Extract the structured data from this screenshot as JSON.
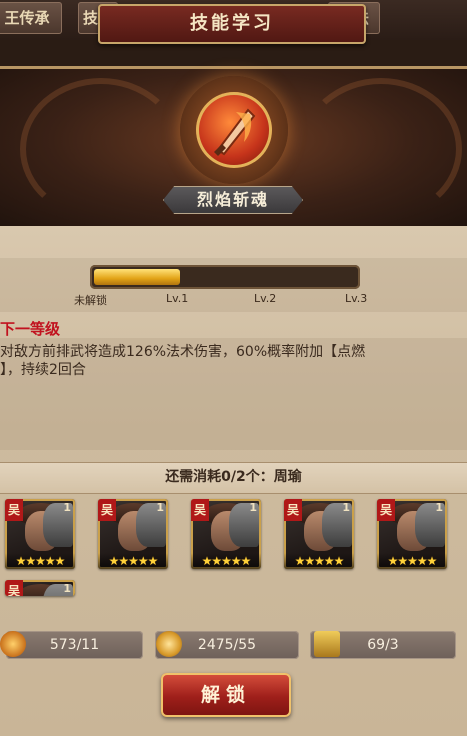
{
  "tabs": [
    {
      "label": "王传承"
    },
    {
      "label": "技能"
    },
    {
      "label": "战法"
    }
  ],
  "title": "技能学习",
  "skill": {
    "name": "烈焰斩魂"
  },
  "progress": {
    "fraction": 0.33,
    "levels": [
      "未解锁",
      "Lv.1",
      "Lv.2",
      "Lv.3"
    ]
  },
  "next_level": {
    "header": "下一等级",
    "desc_line1": "对敌方前排武将造成126%法术伤害，60%概率附加【点燃",
    "desc_line2": "】，持续2回合"
  },
  "requirement": {
    "text": "还需消耗0/2个：周瑜"
  },
  "cards": [
    {
      "faction": "吴",
      "num": "1",
      "stars": "★★★★★"
    },
    {
      "faction": "吴",
      "num": "1",
      "stars": "★★★★★"
    },
    {
      "faction": "吴",
      "num": "1",
      "stars": "★★★★★"
    },
    {
      "faction": "吴",
      "num": "1",
      "stars": "★★★★★"
    },
    {
      "faction": "吴",
      "num": "1",
      "stars": "★★★★★"
    },
    {
      "faction": "吴",
      "num": "1",
      "stars": "★★★★★"
    }
  ],
  "resources": [
    {
      "icon": "coin-icon",
      "value": "573/11"
    },
    {
      "icon": "dragon-token-icon",
      "value": "2475/55"
    },
    {
      "icon": "treasure-chest-icon",
      "value": "69/3"
    }
  ],
  "unlock_button": {
    "label": "解锁"
  },
  "colors": {
    "accent_red": "#c1121f",
    "progress_gold": "#e2a316",
    "frame_gold": "#caa04a"
  }
}
